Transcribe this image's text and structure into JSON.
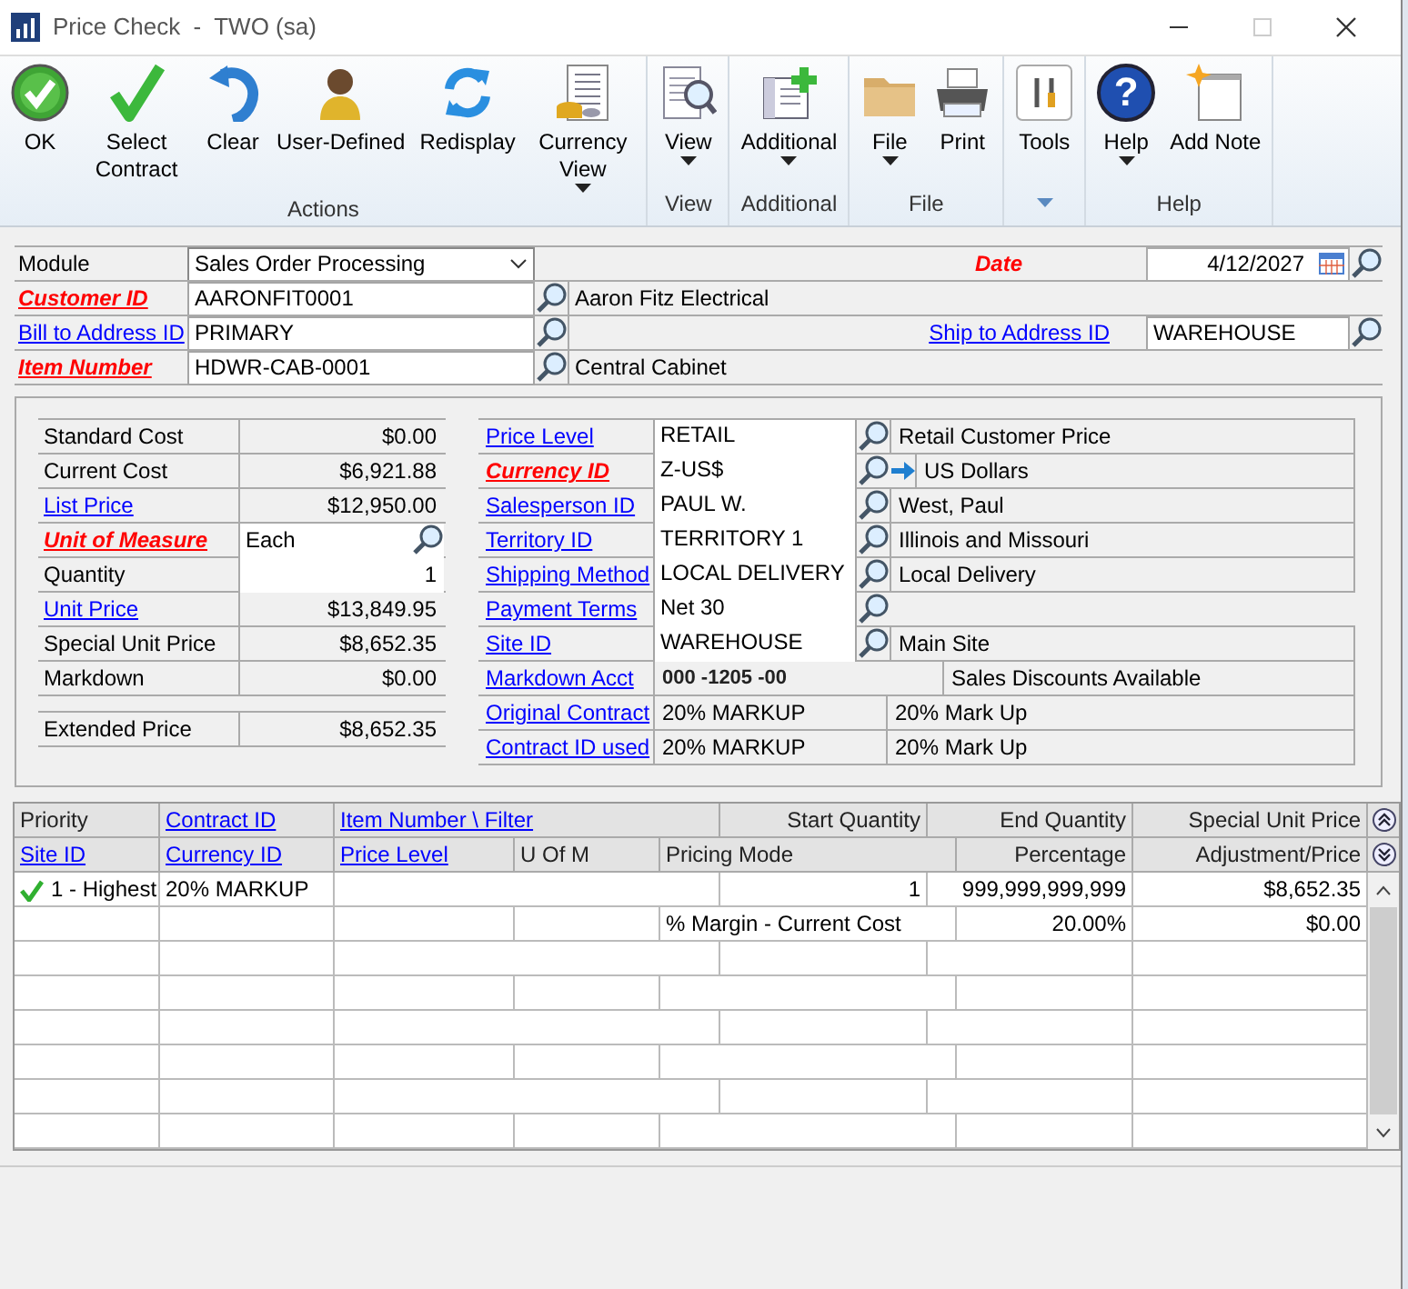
{
  "window": {
    "title": "Price Check  -  TWO (sa)"
  },
  "ribbon": [
    {
      "label": "Actions",
      "buttons": [
        {
          "label": "OK"
        },
        {
          "label": "Select Contract"
        },
        {
          "label": "Clear"
        },
        {
          "label": "User-Defined"
        },
        {
          "label": "Redisplay"
        },
        {
          "label": "Currency View",
          "dropdown": true
        }
      ]
    },
    {
      "label": "View",
      "buttons": [
        {
          "label": "View",
          "dropdown": true
        }
      ]
    },
    {
      "label": "Additional",
      "buttons": [
        {
          "label": "Additional",
          "dropdown": true
        }
      ]
    },
    {
      "label": "File",
      "buttons": [
        {
          "label": "File",
          "dropdown": true
        },
        {
          "label": "Print"
        }
      ]
    },
    {
      "buttons": [
        {
          "label": "Tools"
        }
      ]
    },
    {
      "label": "Help",
      "buttons": [
        {
          "label": "Help",
          "glyph": "?",
          "dropdown": true
        },
        {
          "label": "Add Note"
        }
      ]
    }
  ],
  "header": {
    "module": {
      "label": "Module",
      "link": false,
      "required": false,
      "value": "Sales Order Processing"
    },
    "date": {
      "label": "Date",
      "link": false,
      "required": true,
      "value": "4/12/2027"
    },
    "customer_id": {
      "label": "Customer ID",
      "link": true,
      "required": true,
      "value": "AARONFIT0001",
      "description": "Aaron Fitz Electrical"
    },
    "bill_to": {
      "label": "Bill to Address ID",
      "link": true,
      "required": false,
      "value": "PRIMARY"
    },
    "ship_to": {
      "label": "Ship to Address ID",
      "link": true,
      "required": false,
      "value": "WAREHOUSE"
    },
    "item_number": {
      "label": "Item Number",
      "link": true,
      "required": true,
      "value": "HDWR-CAB-0001",
      "description": "Central Cabinet"
    }
  },
  "pricing": [
    {
      "label": "Standard Cost",
      "link": false,
      "required": false,
      "kind": "readonly",
      "value": "$0.00"
    },
    {
      "label": "Current Cost",
      "link": false,
      "required": false,
      "kind": "readonly",
      "value": "$6,921.88"
    },
    {
      "label": "List Price",
      "link": true,
      "required": false,
      "kind": "readonly",
      "value": "$12,950.00"
    },
    {
      "label": "Unit of Measure",
      "link": true,
      "required": true,
      "kind": "lookup",
      "value": "Each"
    },
    {
      "label": "Quantity",
      "link": false,
      "required": false,
      "kind": "input",
      "value": "1"
    },
    {
      "label": "Unit Price",
      "link": true,
      "required": false,
      "kind": "readonly",
      "value": "$13,849.95"
    },
    {
      "label": "Special Unit Price",
      "link": false,
      "required": false,
      "kind": "readonly",
      "value": "$8,652.35"
    },
    {
      "label": "Markdown",
      "link": false,
      "required": false,
      "kind": "readonly",
      "value": "$0.00"
    }
  ],
  "extended_price": {
    "label": "Extended Price",
    "link": false,
    "required": false,
    "value": "$8,652.35"
  },
  "details": [
    {
      "label": "Price Level",
      "link": true,
      "required": false,
      "kind": "lookup",
      "value": "RETAIL",
      "description": "Retail Customer Price"
    },
    {
      "label": "Currency ID",
      "link": true,
      "required": true,
      "kind": "lookup_arrow",
      "value": "Z-US$",
      "description": "US Dollars"
    },
    {
      "label": "Salesperson ID",
      "link": true,
      "required": false,
      "kind": "lookup",
      "value": "PAUL W.",
      "description": "West, Paul"
    },
    {
      "label": "Territory ID",
      "link": true,
      "required": false,
      "kind": "lookup",
      "value": "TERRITORY 1",
      "description": "Illinois and Missouri"
    },
    {
      "label": "Shipping Method",
      "link": true,
      "required": false,
      "kind": "lookup",
      "value": "LOCAL DELIVERY",
      "description": "Local Delivery"
    },
    {
      "label": "Payment Terms",
      "link": true,
      "required": false,
      "kind": "lookup",
      "value": "Net 30"
    },
    {
      "label": "Site ID",
      "link": true,
      "required": false,
      "kind": "lookup",
      "value": "WAREHOUSE",
      "description": "Main Site"
    },
    {
      "label": "Markdown Acct",
      "link": true,
      "required": false,
      "kind": "account",
      "value": "000 -1205 -00",
      "description": "Sales Discounts Available"
    },
    {
      "label": "Original Contract",
      "link": true,
      "required": false,
      "kind": "plain",
      "value": "20% MARKUP",
      "description": "20% Mark Up"
    },
    {
      "label": "Contract ID used",
      "link": true,
      "required": false,
      "kind": "plain",
      "value": "20% MARKUP",
      "description": "20% Mark Up"
    }
  ],
  "grid": {
    "columns_line1": [
      {
        "label": "Priority",
        "link": false
      },
      {
        "label": "Contract ID",
        "link": true
      },
      {
        "label": "Item Number \\ Filter",
        "link": true
      },
      {
        "label": "Start Quantity",
        "link": false
      },
      {
        "label": "End Quantity",
        "link": false
      },
      {
        "label": "Special Unit Price",
        "link": false
      }
    ],
    "columns_line2": [
      {
        "label": "Site ID",
        "link": true
      },
      {
        "label": "Currency ID",
        "link": true
      },
      {
        "label": "Price Level",
        "link": true
      },
      {
        "label": "U Of M",
        "link": false
      },
      {
        "label": "Pricing Mode",
        "link": false
      },
      {
        "label": "Percentage",
        "link": false
      },
      {
        "label": "Adjustment/Price",
        "link": false
      }
    ],
    "rows": [
      {
        "checked": true,
        "priority": "1 - Highest",
        "contract_id": "20% MARKUP",
        "start_quantity": "1",
        "end_quantity": "999,999,999,999",
        "special_unit_price": "$8,652.35",
        "pricing_mode": "% Margin - Current Cost",
        "percentage": "20.00%",
        "adjustment_price": "$0.00"
      }
    ]
  }
}
